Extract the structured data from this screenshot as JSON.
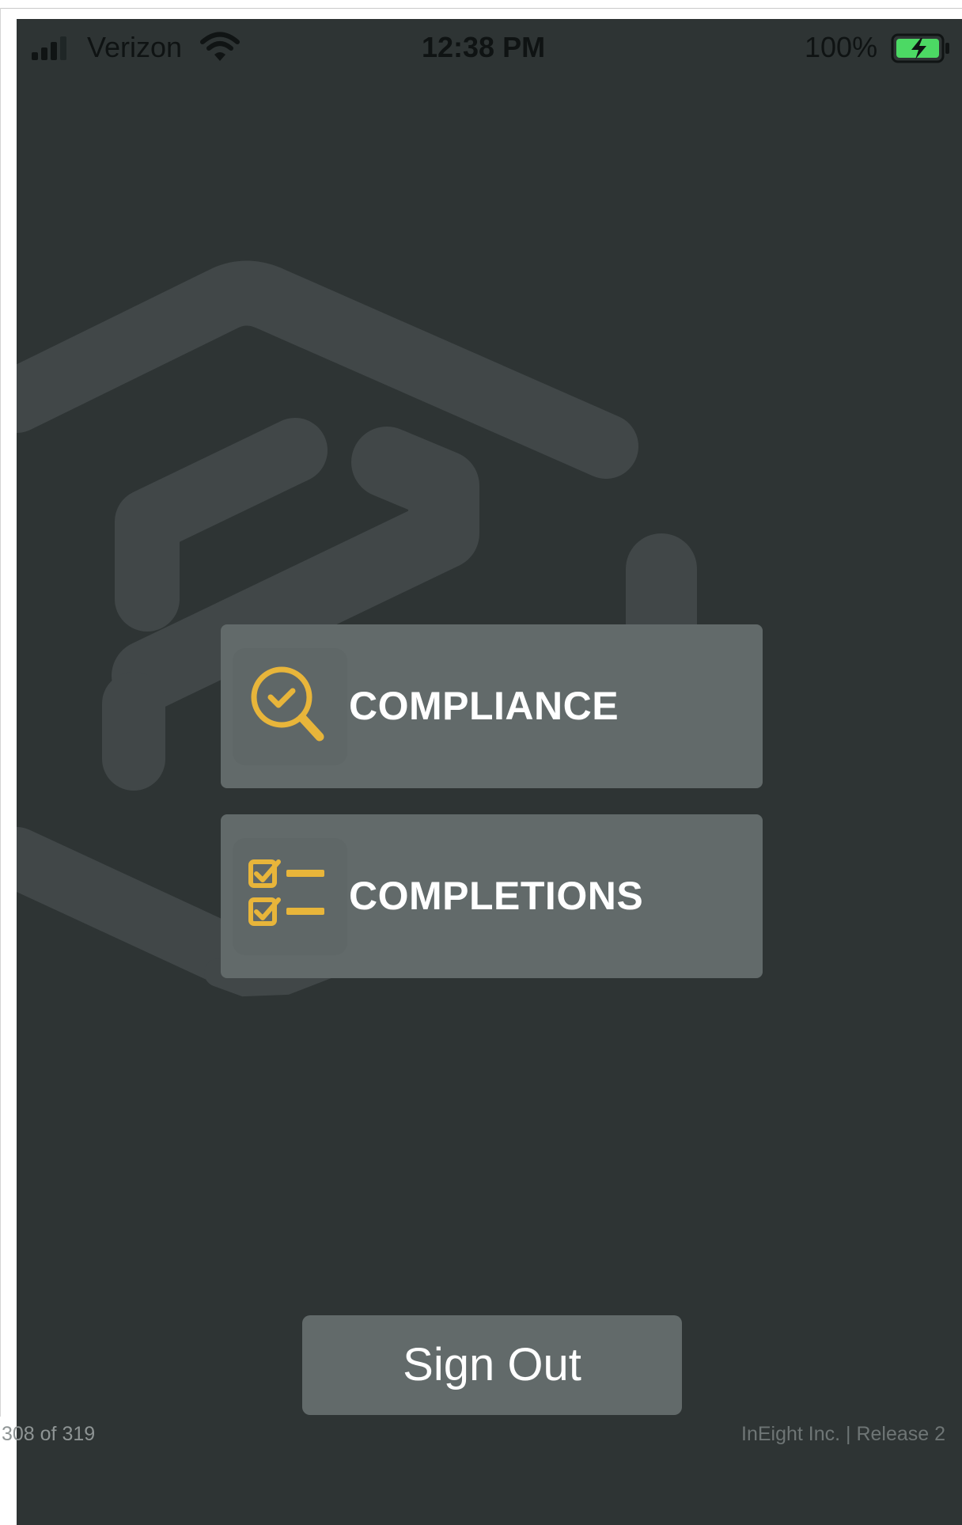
{
  "status_bar": {
    "carrier": "Verizon",
    "time": "12:38 PM",
    "battery_percent": "100%",
    "icons": [
      "signal-bars-icon",
      "wifi-icon",
      "battery-charging-icon"
    ]
  },
  "menu": {
    "items": [
      {
        "label": "COMPLIANCE",
        "icon": "magnifier-check-icon"
      },
      {
        "label": "COMPLETIONS",
        "icon": "checklist-icon"
      }
    ]
  },
  "sign_out_label": "Sign Out",
  "document": {
    "page_number": "308 of 319",
    "footer": "InEight Inc.  |  Release 2"
  },
  "colors": {
    "background": "#2e3434",
    "button": "#626a6a",
    "accent": "#e8b53a",
    "watermark": "#414748",
    "text": "#ffffff"
  }
}
